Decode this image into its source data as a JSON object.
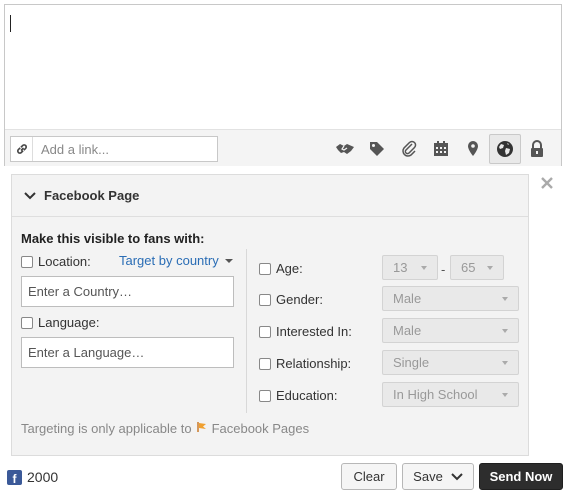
{
  "composer": {
    "link_placeholder": "Add a link...",
    "tools": [
      "handshake-icon",
      "tag-icon",
      "paperclip-icon",
      "calendar-icon",
      "location-pin-icon",
      "globe-icon",
      "lock-icon"
    ]
  },
  "targeting_panel": {
    "title": "Facebook Page",
    "section_title": "Make this visible to fans with:",
    "location": {
      "label": "Location:",
      "dropdown": "Target by country",
      "placeholder": "Enter a Country…"
    },
    "language": {
      "label": "Language:",
      "placeholder": "Enter a Language…"
    },
    "age": {
      "label": "Age:",
      "min": "13",
      "separator": "-",
      "max": "65"
    },
    "gender": {
      "label": "Gender:",
      "value": "Male"
    },
    "interested_in": {
      "label": "Interested In:",
      "value": "Male"
    },
    "relationship": {
      "label": "Relationship:",
      "value": "Single"
    },
    "education": {
      "label": "Education:",
      "value": "In High School"
    },
    "note_prefix": "Targeting is only applicable to",
    "note_link": "Facebook Pages"
  },
  "footer": {
    "fb_icon_letter": "f",
    "fan_count": "2000",
    "clear_label": "Clear",
    "save_label": "Save",
    "send_label": "Send Now"
  },
  "colors": {
    "link_blue": "#2a6db5",
    "facebook_blue": "#3b5998",
    "send_button": "#2d2d2d"
  }
}
